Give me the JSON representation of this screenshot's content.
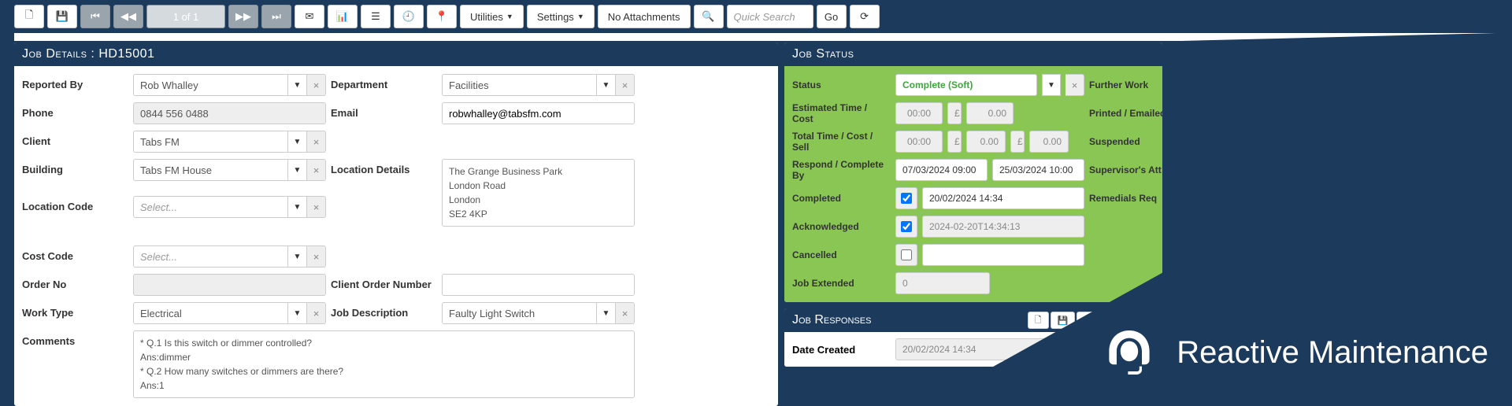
{
  "toolbar": {
    "page_indicator": "1 of 1",
    "utilities_label": "Utilities",
    "settings_label": "Settings",
    "attachments_label": "No Attachments",
    "search_placeholder": "Quick Search",
    "go_label": "Go"
  },
  "job_details": {
    "header": "Job Details : HD15001",
    "labels": {
      "reported_by": "Reported By",
      "department": "Department",
      "phone": "Phone",
      "email": "Email",
      "client": "Client",
      "building": "Building",
      "location_details": "Location Details",
      "location_code": "Location Code",
      "cost_code": "Cost Code",
      "order_no": "Order No",
      "client_order_number": "Client Order Number",
      "work_type": "Work Type",
      "job_description": "Job Description",
      "comments": "Comments"
    },
    "values": {
      "reported_by": "Rob Whalley",
      "department": "Facilities",
      "phone": "0844 556 0488",
      "email": "robwhalley@tabsfm.com",
      "client": "Tabs FM",
      "building": "Tabs FM House",
      "location_details_line1": "The Grange Business Park",
      "location_details_line2": "London Road",
      "location_details_line3": "London",
      "location_details_line4": "SE2 4KP",
      "location_code": "Select...",
      "cost_code": "Select...",
      "order_no": "",
      "client_order_number": "",
      "work_type": "Electrical",
      "job_description": "Faulty Light Switch",
      "comments_l1": "* Q.1 Is this switch or dimmer controlled?",
      "comments_l2": "Ans:dimmer",
      "comments_l3": "* Q.2 How many switches or dimmers are there?",
      "comments_l4": "Ans:1"
    }
  },
  "job_status": {
    "header": "Job Status",
    "labels": {
      "status": "Status",
      "estimated": "Estimated Time / Cost",
      "total": "Total Time / Cost / Sell",
      "respond": "Respond / Complete By",
      "completed": "Completed",
      "acknowledged": "Acknowledged",
      "cancelled": "Cancelled",
      "job_extended": "Job Extended",
      "further_work": "Further Work",
      "printed_emailed": "Printed / Emailed",
      "suspended": "Suspended",
      "supervisors_att": "Supervisor's Att",
      "remedials_req": "Remedials Req"
    },
    "values": {
      "status": "Complete (Soft)",
      "est_time": "00:00",
      "est_cost_prefix": "£",
      "est_cost": "0.00",
      "total_time": "00:00",
      "total_cost": "0.00",
      "total_sell": "0.00",
      "respond_by": "07/03/2024 09:00",
      "complete_by": "25/03/2024 10:00",
      "completed_date": "20/02/2024 14:34",
      "acknowledged_date": "2024-02-20T14:34:13",
      "cancelled": "",
      "job_extended": "0"
    }
  },
  "job_responses": {
    "header": "Job Responses",
    "labels": {
      "date_created": "Date Created"
    },
    "values": {
      "date_created": "20/02/2024 14:34"
    }
  },
  "brand": "Reactive Maintenance"
}
